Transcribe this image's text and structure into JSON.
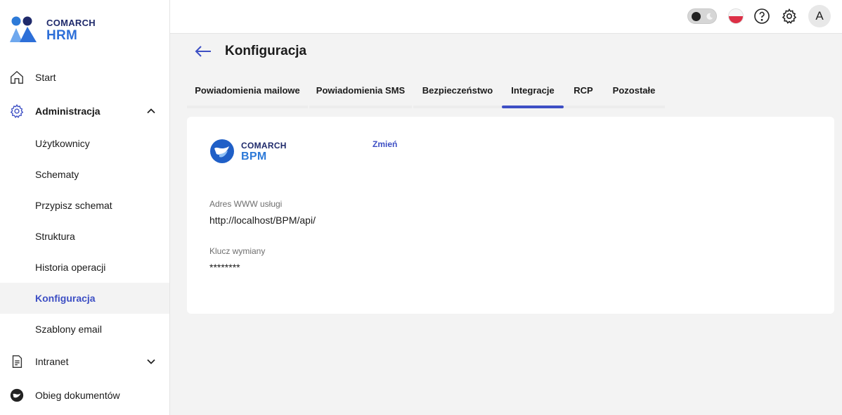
{
  "app": {
    "brand": "COMARCH",
    "product": "HRM"
  },
  "sidebar": {
    "items": [
      {
        "label": "Start",
        "icon": "home-icon"
      },
      {
        "label": "Administracja",
        "icon": "gear-icon",
        "expanded": true
      },
      {
        "label": "Użytkownicy"
      },
      {
        "label": "Schematy"
      },
      {
        "label": "Przypisz schemat"
      },
      {
        "label": "Struktura"
      },
      {
        "label": "Historia operacji"
      },
      {
        "label": "Konfiguracja",
        "active": true
      },
      {
        "label": "Szablony email"
      },
      {
        "label": "Intranet",
        "icon": "document-icon",
        "expanded": false
      },
      {
        "label": "Obieg dokumentów",
        "icon": "workflow-icon"
      }
    ]
  },
  "topbar": {
    "avatar_initial": "A",
    "theme_toggle": "dark-mode-toggle",
    "language": "polish-flag-icon",
    "help_icon": "help-icon",
    "settings_icon": "gear-icon"
  },
  "page": {
    "title": "Konfiguracja",
    "back_icon": "arrow-left-icon"
  },
  "tabs": [
    {
      "label": "Powiadomienia mailowe"
    },
    {
      "label": "Powiadomienia SMS"
    },
    {
      "label": "Bezpieczeństwo"
    },
    {
      "label": "Integracje",
      "active": true
    },
    {
      "label": "RCP"
    },
    {
      "label": "Pozostałe"
    }
  ],
  "integration": {
    "logo_brand": "COMARCH",
    "logo_product": "BPM",
    "change_label": "Zmień",
    "fields": [
      {
        "label": "Adres WWW usługi",
        "value": "http://localhost/BPM/api/"
      },
      {
        "label": "Klucz wymiany",
        "value": "********"
      }
    ]
  },
  "colors": {
    "accent": "#3d4fc4",
    "brand_dark": "#1f2a6b",
    "brand_blue": "#2d6fd8"
  }
}
